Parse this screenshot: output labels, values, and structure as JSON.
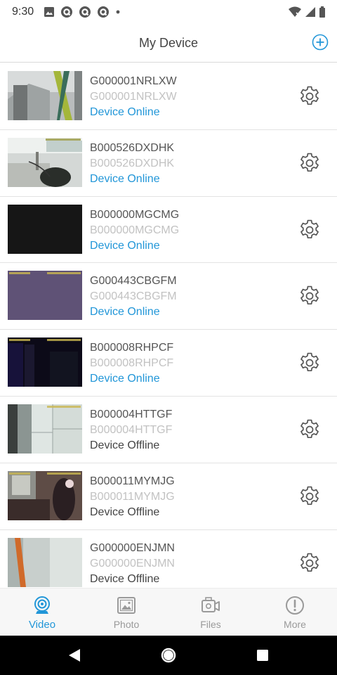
{
  "status_bar": {
    "time": "9:30",
    "left_icons": [
      "image-icon",
      "q-app-icon",
      "q-app-icon",
      "q-app-icon",
      "dot-icon"
    ],
    "right_icons": [
      "wifi-x-icon",
      "signal-icon",
      "battery-icon"
    ]
  },
  "header": {
    "title": "My Device",
    "add_icon": "add-circle-icon"
  },
  "devices": [
    {
      "name": "G000001NRLXW",
      "sub": "G000001NRLXW",
      "status": "Device Online",
      "online": true,
      "thumb": "thumb-1"
    },
    {
      "name": "B000526DXDHK",
      "sub": "B000526DXDHK",
      "status": "Device Online",
      "online": true,
      "thumb": "thumb-2"
    },
    {
      "name": "B000000MGCMG",
      "sub": "B000000MGCMG",
      "status": "Device Online",
      "online": true,
      "thumb": "thumb-3"
    },
    {
      "name": "G000443CBGFM",
      "sub": "G000443CBGFM",
      "status": "Device Online",
      "online": true,
      "thumb": "thumb-4"
    },
    {
      "name": "B000008RHPCF",
      "sub": "B000008RHPCF",
      "status": "Device Online",
      "online": true,
      "thumb": "thumb-5"
    },
    {
      "name": "B000004HTTGF",
      "sub": "B000004HTTGF",
      "status": "Device Offline",
      "online": false,
      "thumb": "thumb-6"
    },
    {
      "name": "B000011MYMJG",
      "sub": "B000011MYMJG",
      "status": "Device Offline",
      "online": false,
      "thumb": "thumb-7"
    },
    {
      "name": "G000000ENJMN",
      "sub": "G000000ENJMN",
      "status": "Device Offline",
      "online": false,
      "thumb": "thumb-8"
    }
  ],
  "tabs": [
    {
      "label": "Video",
      "icon": "webcam-icon",
      "active": true
    },
    {
      "label": "Photo",
      "icon": "photo-icon",
      "active": false
    },
    {
      "label": "Files",
      "icon": "camera-files-icon",
      "active": false
    },
    {
      "label": "More",
      "icon": "info-circle-icon",
      "active": false
    }
  ],
  "colors": {
    "accent": "#2196d8",
    "offline_text": "#444444",
    "sub_text": "#c2c2c2",
    "tab_inactive": "#9a9a9a"
  }
}
